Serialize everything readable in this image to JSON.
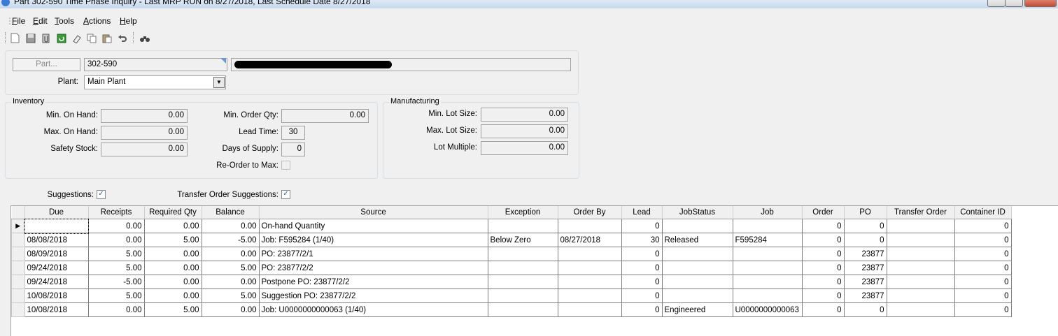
{
  "window": {
    "title": "Part 302-590 Time Phase Inquiry  - Last MRP RUN on 8/27/2018, Last Schedule Date  8/27/2018"
  },
  "menu": [
    {
      "label": "File",
      "underline": "F",
      "rest": "ile"
    },
    {
      "label": "Edit",
      "underline": "E",
      "rest": "dit"
    },
    {
      "label": "Tools",
      "underline": "T",
      "rest": "ools"
    },
    {
      "label": "Actions",
      "underline": "A",
      "rest": "ctions"
    },
    {
      "label": "Help",
      "underline": "H",
      "rest": "elp"
    }
  ],
  "toolbar": [
    "new-icon",
    "save-icon",
    "attach-icon",
    "refresh-icon",
    "clear-icon",
    "copy-icon",
    "paste-icon",
    "undo-icon",
    "find-icon"
  ],
  "part": {
    "button_label": "Part...",
    "number": "302-590",
    "description": "",
    "plant_label": "Plant:",
    "plant_value": "Main Plant"
  },
  "inventory": {
    "title": "Inventory",
    "min_on_hand_label": "Min. On Hand:",
    "min_on_hand": "0.00",
    "max_on_hand_label": "Max. On Hand:",
    "max_on_hand": "0.00",
    "safety_stock_label": "Safety Stock:",
    "safety_stock": "0.00",
    "min_order_qty_label": "Min. Order Qty:",
    "min_order_qty": "0.00",
    "lead_time_label": "Lead Time:",
    "lead_time": "30",
    "days_supply_label": "Days of Supply:",
    "days_supply": "0",
    "reorder_label": "Re-Order to Max:",
    "reorder_checked": false
  },
  "manufacturing": {
    "title": "Manufacturing",
    "min_lot_label": "Min. Lot Size:",
    "min_lot": "0.00",
    "max_lot_label": "Max. Lot Size:",
    "max_lot": "0.00",
    "lot_multiple_label": "Lot Multiple:",
    "lot_multiple": "0.00"
  },
  "options": {
    "suggestions_label": "Suggestions:",
    "suggestions_checked": true,
    "transfer_label": "Transfer Order Suggestions:",
    "transfer_checked": true
  },
  "grid": {
    "columns": [
      "Due",
      "Receipts",
      "Required Qty",
      "Balance",
      "Source",
      "Exception",
      "Order By",
      "Lead",
      "JobStatus",
      "Job",
      "Order",
      "PO",
      "Transfer Order",
      "Container ID"
    ],
    "rows": [
      [
        "",
        "0.00",
        "0.00",
        "0.00",
        "On-hand Quantity",
        "",
        "",
        "0",
        "",
        "",
        "0",
        "0",
        "",
        "0"
      ],
      [
        "08/08/2018",
        "0.00",
        "5.00",
        "-5.00",
        "Job: F595284 (1/40)",
        "Below Zero",
        "08/27/2018",
        "30",
        "Released",
        "F595284",
        "0",
        "0",
        "",
        "0"
      ],
      [
        "08/09/2018",
        "5.00",
        "0.00",
        "0.00",
        "PO: 23877/2/1",
        "",
        "",
        "0",
        "",
        "",
        "0",
        "23877",
        "",
        "0"
      ],
      [
        "09/24/2018",
        "5.00",
        "0.00",
        "5.00",
        "PO: 23877/2/2",
        "",
        "",
        "0",
        "",
        "",
        "0",
        "23877",
        "",
        "0"
      ],
      [
        "09/24/2018",
        "-5.00",
        "0.00",
        "0.00",
        "Postpone PO: 23877/2/2",
        "",
        "",
        "0",
        "",
        "",
        "0",
        "23877",
        "",
        "0"
      ],
      [
        "10/08/2018",
        "5.00",
        "0.00",
        "5.00",
        "Suggestion PO: 23877/2/2",
        "",
        "",
        "0",
        "",
        "",
        "0",
        "23877",
        "",
        "0"
      ],
      [
        "10/08/2018",
        "0.00",
        "5.00",
        "0.00",
        "Job: U0000000000063 (1/40)",
        "",
        "",
        "0",
        "Engineered",
        "U0000000000063",
        "0",
        "0",
        "",
        "0"
      ]
    ],
    "selected_row": 0
  }
}
